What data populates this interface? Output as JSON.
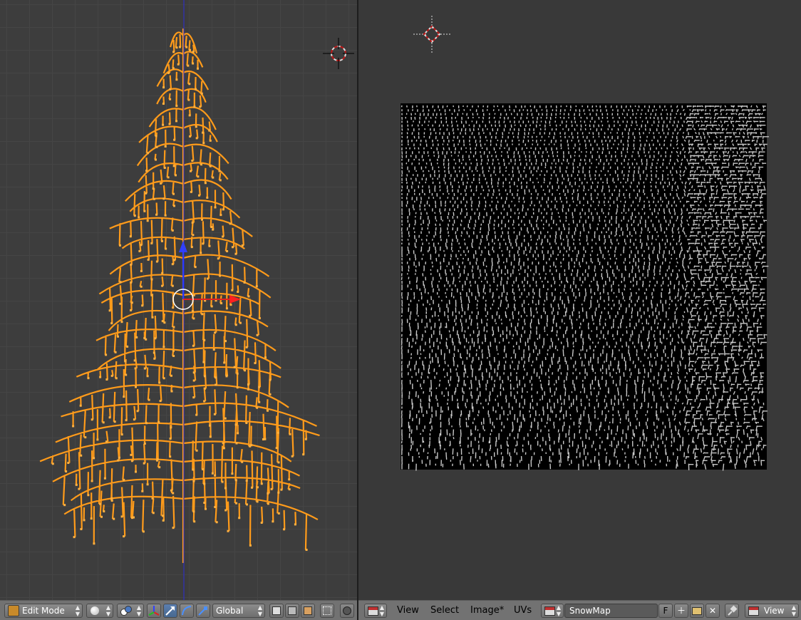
{
  "viewport3d": {
    "header": {
      "mode_label": "Edit Mode",
      "orientation_label": "Global"
    }
  },
  "uv_editor": {
    "menu": {
      "view": "View",
      "select": "Select",
      "image": "Image*",
      "uvs": "UVs"
    },
    "image_name": "SnowMap",
    "fake_user_label": "F",
    "pivot_view_label": "View"
  },
  "colors": {
    "selection": "#ff9b1a",
    "background": "#3d3d3d",
    "header": "#727272"
  }
}
